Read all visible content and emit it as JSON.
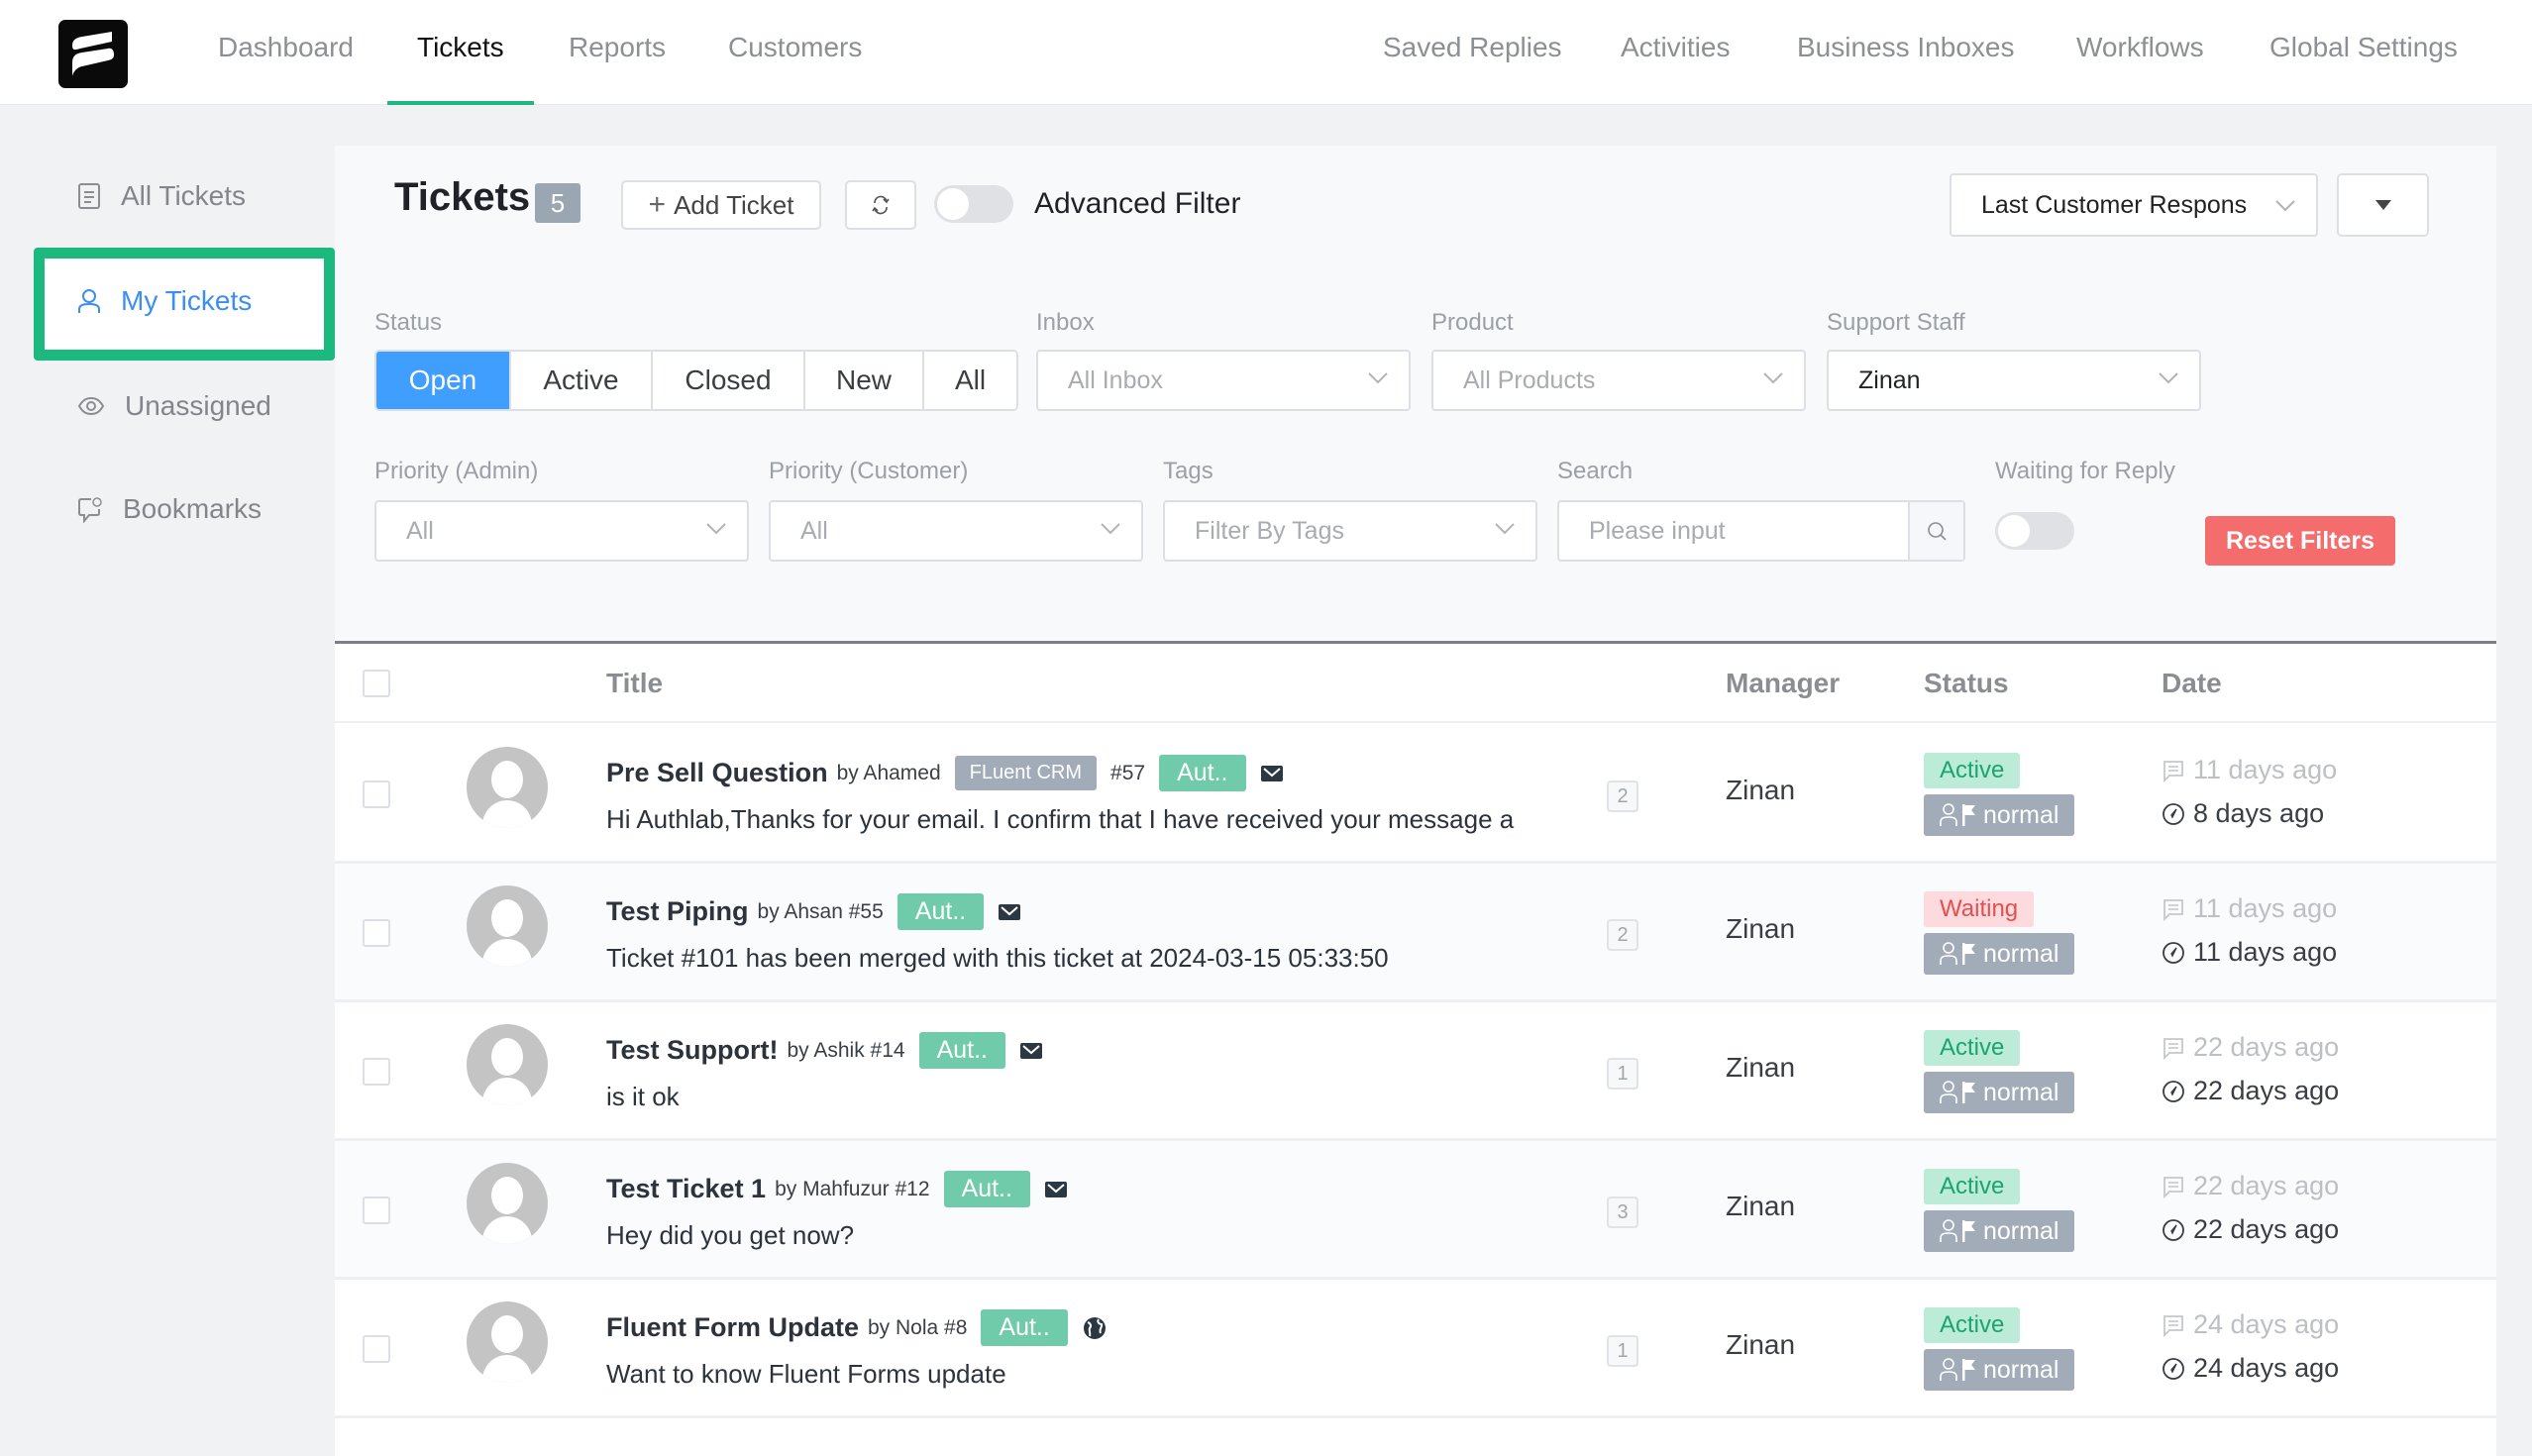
{
  "topnav": {
    "left": [
      {
        "label": "Dashboard",
        "active": false
      },
      {
        "label": "Tickets",
        "active": true
      },
      {
        "label": "Reports",
        "active": false
      },
      {
        "label": "Customers",
        "active": false
      }
    ],
    "right": [
      {
        "label": "Saved Replies"
      },
      {
        "label": "Activities"
      },
      {
        "label": "Business Inboxes"
      },
      {
        "label": "Workflows"
      },
      {
        "label": "Global Settings"
      }
    ]
  },
  "sidebar": {
    "items": [
      {
        "label": "All Tickets",
        "icon": "document-icon"
      },
      {
        "label": "My Tickets",
        "icon": "user-icon",
        "active": true
      },
      {
        "label": "Unassigned",
        "icon": "eye-icon"
      },
      {
        "label": "Bookmarks",
        "icon": "chat-at-icon"
      }
    ]
  },
  "header": {
    "title": "Tickets",
    "count": "5",
    "add_ticket": "Add Ticket",
    "advanced_filter": "Advanced Filter",
    "sort_select": "Last Customer Respons",
    "advanced_filter_on": false
  },
  "filters": {
    "status_label": "Status",
    "status_options": [
      "Open",
      "Active",
      "Closed",
      "New",
      "All"
    ],
    "status_selected": "Open",
    "inbox_label": "Inbox",
    "inbox_value": "All Inbox",
    "product_label": "Product",
    "product_value": "All Products",
    "staff_label": "Support Staff",
    "staff_value": "Zinan",
    "priority_admin_label": "Priority (Admin)",
    "priority_admin_value": "All",
    "priority_customer_label": "Priority (Customer)",
    "priority_customer_value": "All",
    "tags_label": "Tags",
    "tags_placeholder": "Filter By Tags",
    "search_label": "Search",
    "search_placeholder": "Please input",
    "search_value": "",
    "waiting_label": "Waiting for Reply",
    "waiting_on": false,
    "reset": "Reset Filters"
  },
  "table": {
    "columns": [
      "Title",
      "Manager",
      "Status",
      "Date"
    ],
    "rows": [
      {
        "title": "Pre Sell Question",
        "by": "by Ahamed",
        "product": "FLuent CRM",
        "number": "#57",
        "tag": "Aut..",
        "source_icon": "envelope-icon",
        "excerpt": "Hi Authlab,Thanks for your email. I confirm that I have received your message a",
        "replies": "2",
        "manager": "Zinan",
        "status": "Active",
        "priority": "normal",
        "last_response": "11 days ago",
        "waiting_since": "8 days ago"
      },
      {
        "title": "Test Piping",
        "by": "by Ahsan #55",
        "product": "",
        "number": "",
        "tag": "Aut..",
        "source_icon": "envelope-icon",
        "excerpt": "Ticket #101 has been merged with this ticket at 2024-03-15 05:33:50",
        "replies": "2",
        "manager": "Zinan",
        "status": "Waiting",
        "priority": "normal",
        "last_response": "11 days ago",
        "waiting_since": "11 days ago"
      },
      {
        "title": "Test Support!",
        "by": "by Ashik #14",
        "product": "",
        "number": "",
        "tag": "Aut..",
        "source_icon": "envelope-icon",
        "excerpt": "is it ok",
        "replies": "1",
        "manager": "Zinan",
        "status": "Active",
        "priority": "normal",
        "last_response": "22 days ago",
        "waiting_since": "22 days ago"
      },
      {
        "title": "Test Ticket 1",
        "by": "by Mahfuzur #12",
        "product": "",
        "number": "",
        "tag": "Aut..",
        "source_icon": "envelope-icon",
        "excerpt": "Hey did you get now?",
        "replies": "3",
        "manager": "Zinan",
        "status": "Active",
        "priority": "normal",
        "last_response": "22 days ago",
        "waiting_since": "22 days ago"
      },
      {
        "title": "Fluent Form Update",
        "by": "by Nola #8",
        "product": "",
        "number": "",
        "tag": "Aut..",
        "source_icon": "globe-icon",
        "excerpt": "Want to know Fluent Forms update",
        "replies": "1",
        "manager": "Zinan",
        "status": "Active",
        "priority": "normal",
        "last_response": "24 days ago",
        "waiting_since": "24 days ago"
      }
    ]
  },
  "colors": {
    "accent_green": "#1fb883",
    "primary_blue": "#409eff",
    "reset_red": "#f56c6c",
    "active_bg": "#bcebd8",
    "waiting_bg": "#fcdadd"
  }
}
